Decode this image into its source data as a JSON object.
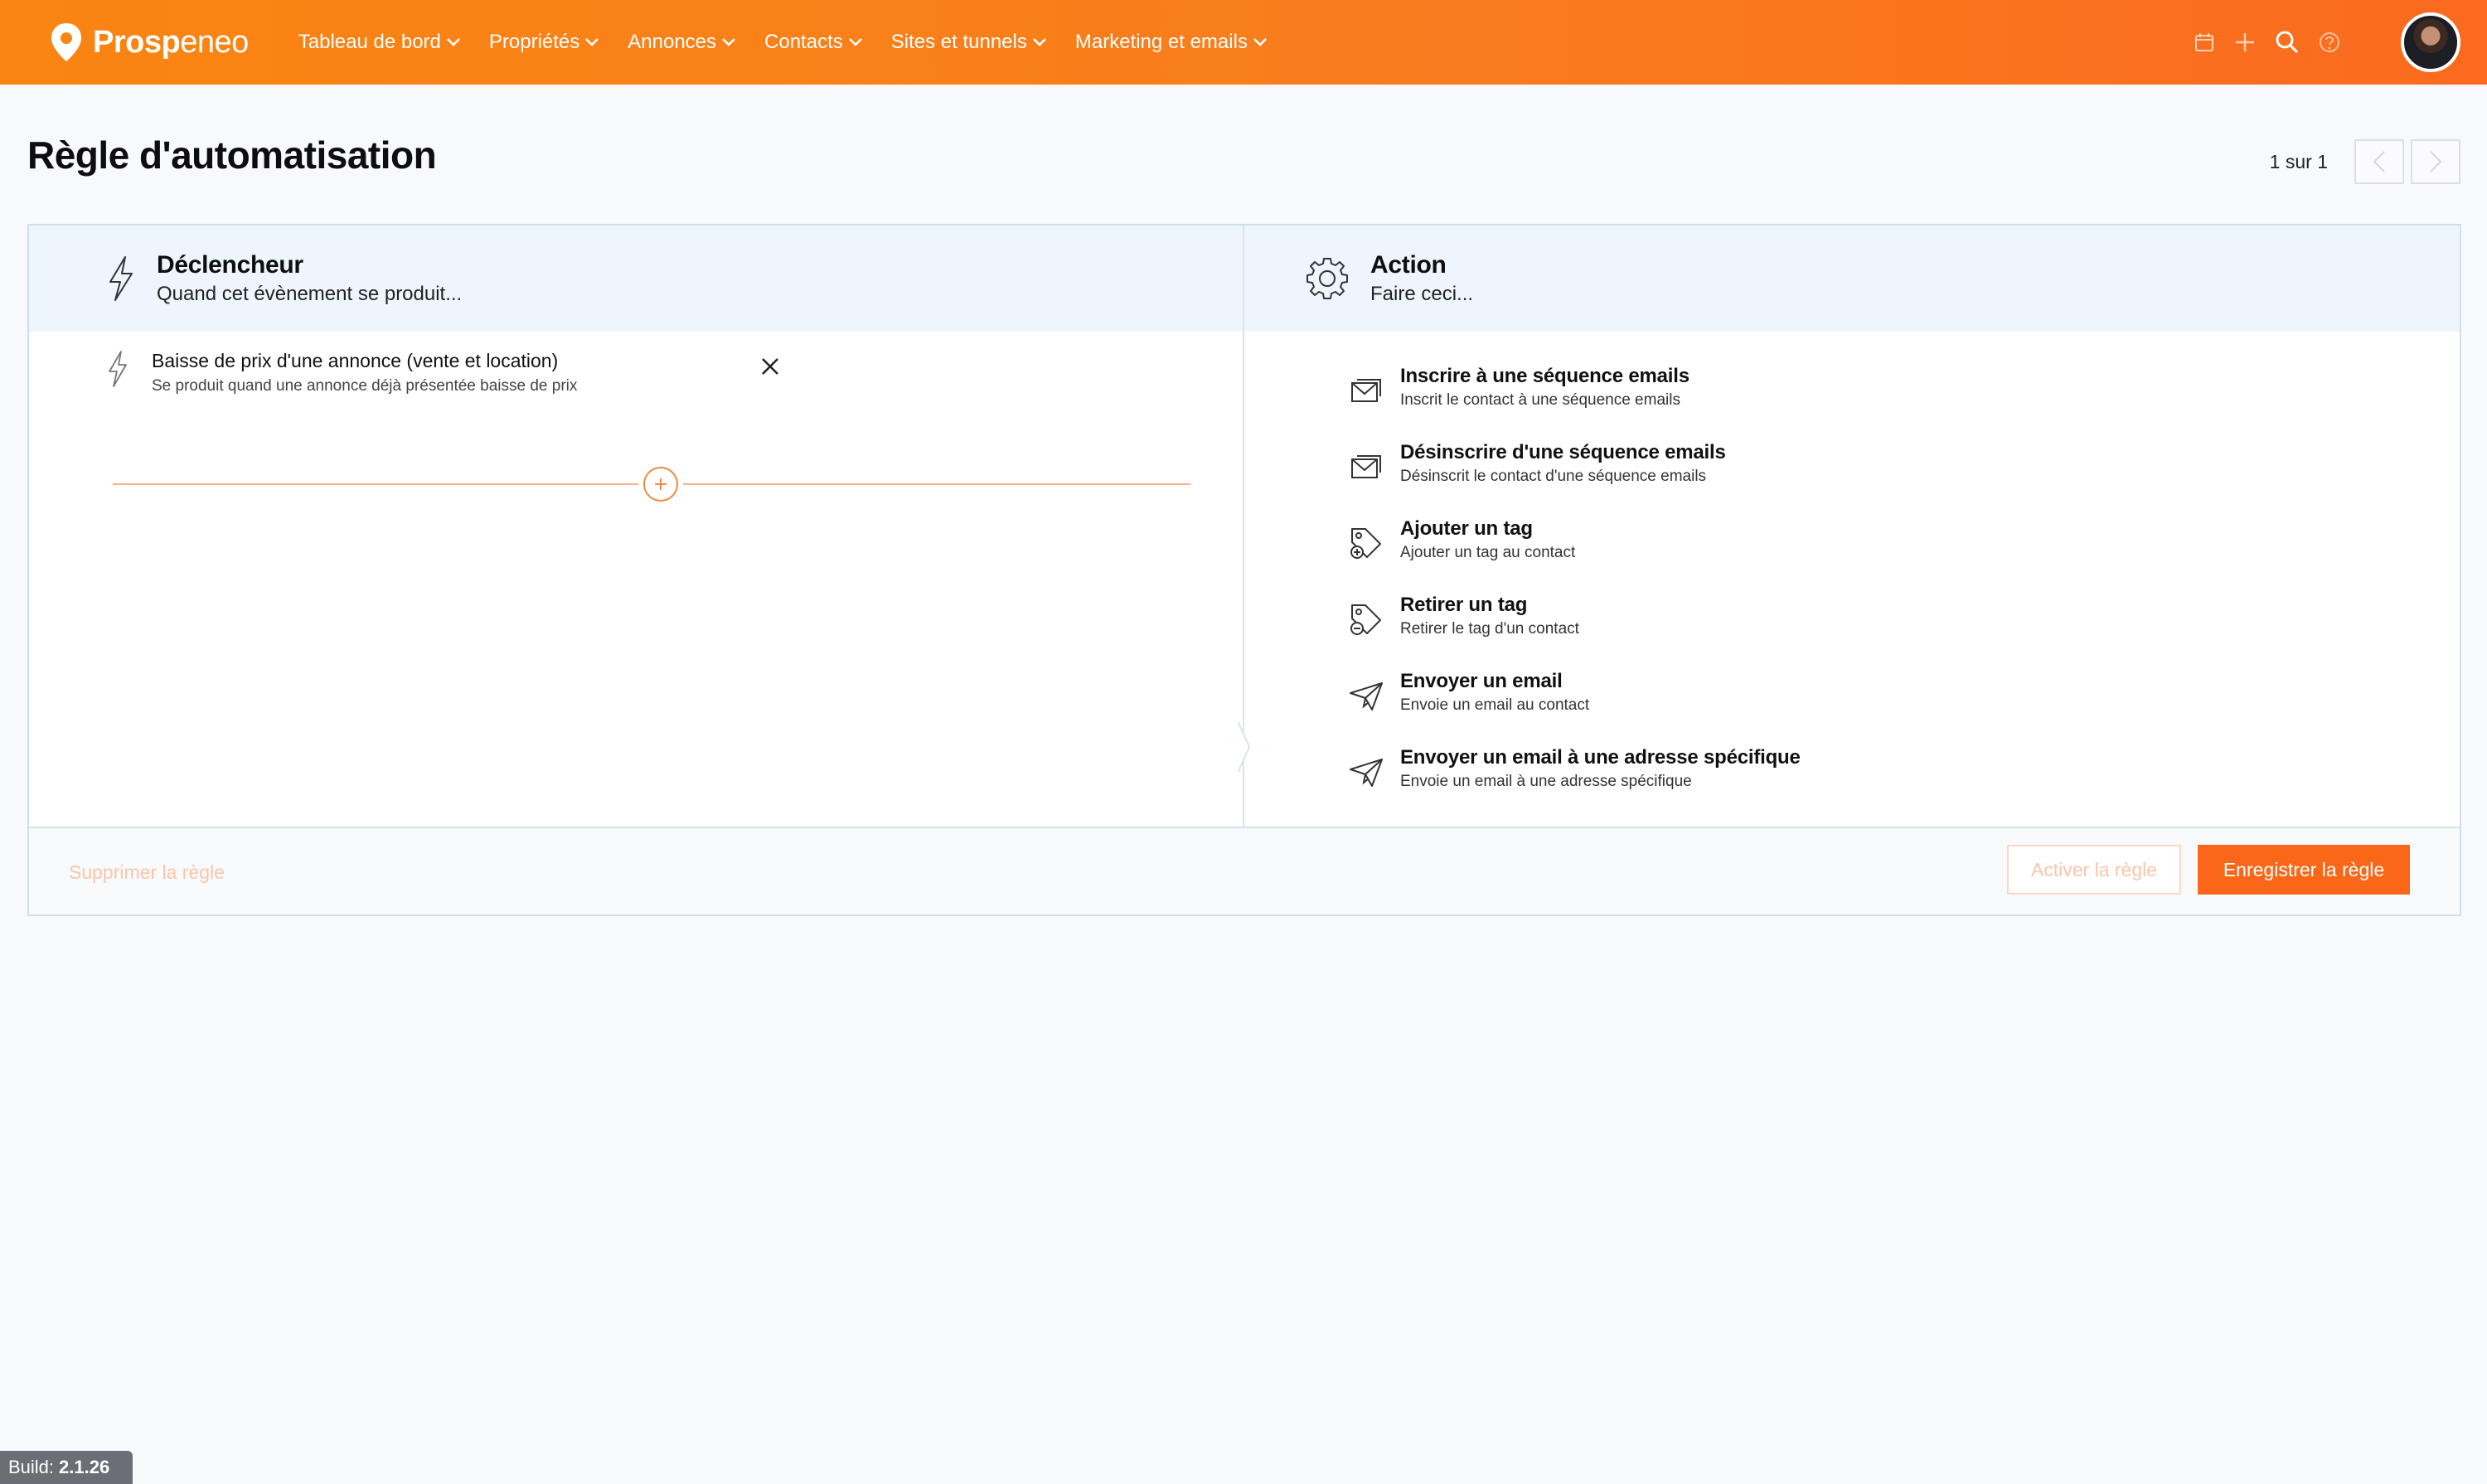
{
  "app": {
    "brand_bold": "Prosp",
    "brand_light": "eneo",
    "accent_color": "#fa6718"
  },
  "nav": {
    "items": [
      {
        "label": "Tableau de bord",
        "icon": "chevron-down-icon"
      },
      {
        "label": "Propriétés",
        "icon": "chevron-down-icon"
      },
      {
        "label": "Annonces",
        "icon": "chevron-down-icon"
      },
      {
        "label": "Contacts",
        "icon": "chevron-down-icon"
      },
      {
        "label": "Sites et tunnels",
        "icon": "chevron-down-icon"
      },
      {
        "label": "Marketing et emails",
        "icon": "chevron-down-icon"
      }
    ],
    "right_icons": [
      "calendar-icon",
      "plus-icon",
      "search-icon",
      "help-icon",
      "avatar"
    ]
  },
  "page": {
    "title": "Règle d'automatisation",
    "pager_text": "1 sur 1"
  },
  "trigger_panel": {
    "title": "Déclencheur",
    "subtitle": "Quand cet évènement se produit...",
    "icon": "lightning-icon",
    "selected_trigger": {
      "title": "Baisse de prix d'une annonce (vente et location)",
      "description": "Se produit quand une annonce déjà présentée baisse de prix"
    }
  },
  "action_panel": {
    "title": "Action",
    "subtitle": "Faire ceci...",
    "icon": "gear-icon",
    "actions": [
      {
        "title": "Inscrire à une séquence emails",
        "description": "Inscrit le contact à une séquence emails",
        "icon": "email-sequence-icon"
      },
      {
        "title": "Désinscrire d'une séquence emails",
        "description": "Désinscrit le contact d'une séquence emails",
        "icon": "email-sequence-icon"
      },
      {
        "title": "Ajouter un tag",
        "description": "Ajouter un tag au contact",
        "icon": "tag-add-icon"
      },
      {
        "title": "Retirer un tag",
        "description": "Retirer le tag d'un contact",
        "icon": "tag-remove-icon"
      },
      {
        "title": "Envoyer un email",
        "description": "Envoie un email au contact",
        "icon": "paper-plane-icon"
      },
      {
        "title": "Envoyer un email à une adresse spécifique",
        "description": "Envoie un email à une adresse spécifique",
        "icon": "paper-plane-icon"
      }
    ]
  },
  "footer": {
    "delete_label": "Supprimer la règle",
    "activate_label": "Activer la règle",
    "save_label": "Enregistrer la règle"
  },
  "build": {
    "label": "Build:",
    "version": "2.1.26"
  }
}
